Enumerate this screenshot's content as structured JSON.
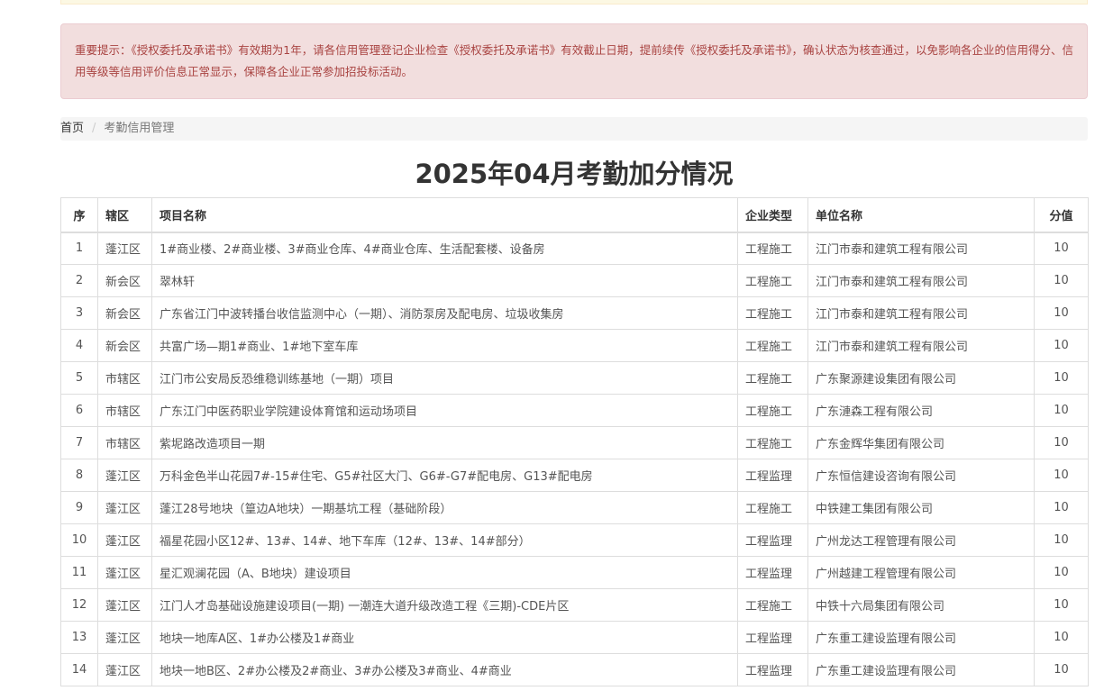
{
  "alert": {
    "text": "重要提示：《授权委托及承诺书》有效期为1年，请各信用管理登记企业检查《授权委托及承诺书》有效截止日期，提前续传《授权委托及承诺书》，确认状态为核查通过，以免影响各企业的信用得分、信用等级等信用评价信息正常显示，保障各企业正常参加招投标活动。"
  },
  "breadcrumb": {
    "home": "首页",
    "separator": "/",
    "current": "考勤信用管理"
  },
  "page_title": "2025年04月考勤加分情况",
  "table": {
    "headers": {
      "seq": "序",
      "district": "辖区",
      "project": "项目名称",
      "type": "企业类型",
      "company": "单位名称",
      "score": "分值"
    },
    "rows": [
      {
        "seq": "1",
        "district": "蓬江区",
        "project": "1#商业楼、2#商业楼、3#商业仓库、4#商业仓库、生活配套楼、设备房",
        "type": "工程施工",
        "company": "江门市泰和建筑工程有限公司",
        "score": "10"
      },
      {
        "seq": "2",
        "district": "新会区",
        "project": "翠林轩",
        "type": "工程施工",
        "company": "江门市泰和建筑工程有限公司",
        "score": "10"
      },
      {
        "seq": "3",
        "district": "新会区",
        "project": "广东省江门中波转播台收信监测中心（一期）、消防泵房及配电房、垃圾收集房",
        "type": "工程施工",
        "company": "江门市泰和建筑工程有限公司",
        "score": "10"
      },
      {
        "seq": "4",
        "district": "新会区",
        "project": "共富广场—期1#商业、1#地下室车库",
        "type": "工程施工",
        "company": "江门市泰和建筑工程有限公司",
        "score": "10"
      },
      {
        "seq": "5",
        "district": "市辖区",
        "project": "江门市公安局反恐维稳训练基地（一期）项目",
        "type": "工程施工",
        "company": "广东聚源建设集团有限公司",
        "score": "10"
      },
      {
        "seq": "6",
        "district": "市辖区",
        "project": "广东江门中医药职业学院建设体育馆和运动场项目",
        "type": "工程施工",
        "company": "广东漣森工程有限公司",
        "score": "10"
      },
      {
        "seq": "7",
        "district": "市辖区",
        "project": "紫坭路改造项目一期",
        "type": "工程施工",
        "company": "广东金辉华集团有限公司",
        "score": "10"
      },
      {
        "seq": "8",
        "district": "蓬江区",
        "project": "万科金色半山花园7#-15#住宅、G5#社区大门、G6#-G7#配电房、G13#配电房",
        "type": "工程监理",
        "company": "广东恒信建设咨询有限公司",
        "score": "10"
      },
      {
        "seq": "9",
        "district": "蓬江区",
        "project": "蓬江28号地块（篁边A地块）一期基坑工程（基础阶段）",
        "type": "工程施工",
        "company": "中铁建工集团有限公司",
        "score": "10"
      },
      {
        "seq": "10",
        "district": "蓬江区",
        "project": "福星花园小区12#、13#、14#、地下车库（12#、13#、14#部分）",
        "type": "工程监理",
        "company": "广州龙达工程管理有限公司",
        "score": "10"
      },
      {
        "seq": "11",
        "district": "蓬江区",
        "project": "星汇观澜花园（A、B地块）建设项目",
        "type": "工程监理",
        "company": "广州越建工程管理有限公司",
        "score": "10"
      },
      {
        "seq": "12",
        "district": "蓬江区",
        "project": "江门人才岛基础设施建设项目(一期) 一潮连大道升级改造工程《三期)-CDE片区",
        "type": "工程施工",
        "company": "中铁十六局集团有限公司",
        "score": "10"
      },
      {
        "seq": "13",
        "district": "蓬江区",
        "project": "地块一地库A区、1#办公楼及1#商业",
        "type": "工程监理",
        "company": "广东重工建设监理有限公司",
        "score": "10"
      },
      {
        "seq": "14",
        "district": "蓬江区",
        "project": "地块一地B区、2#办公楼及2#商业、3#办公楼及3#商业、4#商业",
        "type": "工程监理",
        "company": "广东重工建设监理有限公司",
        "score": "10"
      }
    ]
  }
}
